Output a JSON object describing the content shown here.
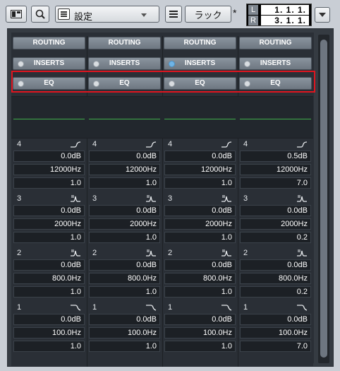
{
  "toolbar": {
    "preset_label": "設定",
    "rack_label": "ラック",
    "rack_marker": "*",
    "locator_left_key": "L",
    "locator_left_value": "1. 1. 1.",
    "locator_right_key": "R",
    "locator_right_value": "3. 1. 1."
  },
  "columns": [
    {
      "routing_label": "ROUTING",
      "inserts_label": "INSERTS",
      "inserts_active": false,
      "eq_label": "EQ",
      "bands": [
        {
          "num": "4",
          "shape": "high-shelf",
          "gain": "0.0dB",
          "freq": "12000Hz",
          "q": "1.0"
        },
        {
          "num": "3",
          "shape": "peak",
          "gain": "0.0dB",
          "freq": "2000Hz",
          "q": "1.0"
        },
        {
          "num": "2",
          "shape": "peak",
          "gain": "0.0dB",
          "freq": "800.0Hz",
          "q": "1.0"
        },
        {
          "num": "1",
          "shape": "low-cut",
          "gain": "0.0dB",
          "freq": "100.0Hz",
          "q": "1.0"
        }
      ]
    },
    {
      "routing_label": "ROUTING",
      "inserts_label": "INSERTS",
      "inserts_active": false,
      "eq_label": "EQ",
      "bands": [
        {
          "num": "4",
          "shape": "high-shelf",
          "gain": "0.0dB",
          "freq": "12000Hz",
          "q": "1.0"
        },
        {
          "num": "3",
          "shape": "peak",
          "gain": "0.0dB",
          "freq": "2000Hz",
          "q": "1.0"
        },
        {
          "num": "2",
          "shape": "peak",
          "gain": "0.0dB",
          "freq": "800.0Hz",
          "q": "1.0"
        },
        {
          "num": "1",
          "shape": "low-cut",
          "gain": "0.0dB",
          "freq": "100.0Hz",
          "q": "1.0"
        }
      ]
    },
    {
      "routing_label": "ROUTING",
      "inserts_label": "INSERTS",
      "inserts_active": true,
      "eq_label": "EQ",
      "bands": [
        {
          "num": "4",
          "shape": "high-shelf",
          "gain": "0.0dB",
          "freq": "12000Hz",
          "q": "1.0"
        },
        {
          "num": "3",
          "shape": "peak",
          "gain": "0.0dB",
          "freq": "2000Hz",
          "q": "1.0"
        },
        {
          "num": "2",
          "shape": "peak",
          "gain": "0.0dB",
          "freq": "800.0Hz",
          "q": "1.0"
        },
        {
          "num": "1",
          "shape": "low-cut",
          "gain": "0.0dB",
          "freq": "100.0Hz",
          "q": "1.0"
        }
      ]
    },
    {
      "routing_label": "ROUTING",
      "inserts_label": "INSERTS",
      "inserts_active": false,
      "eq_label": "EQ",
      "bands": [
        {
          "num": "4",
          "shape": "high-shelf",
          "gain": "0.5dB",
          "freq": "12000Hz",
          "q": "7.0"
        },
        {
          "num": "3",
          "shape": "peak",
          "gain": "0.0dB",
          "freq": "2000Hz",
          "q": "0.2"
        },
        {
          "num": "2",
          "shape": "peak",
          "gain": "0.0dB",
          "freq": "800.0Hz",
          "q": "0.2"
        },
        {
          "num": "1",
          "shape": "low-cut",
          "gain": "0.0dB",
          "freq": "100.0Hz",
          "q": "7.0"
        }
      ]
    }
  ],
  "colors": {
    "highlight": "#e0151f",
    "eq_curve": "#3fae4b",
    "led_active": "#6fb4e6"
  }
}
